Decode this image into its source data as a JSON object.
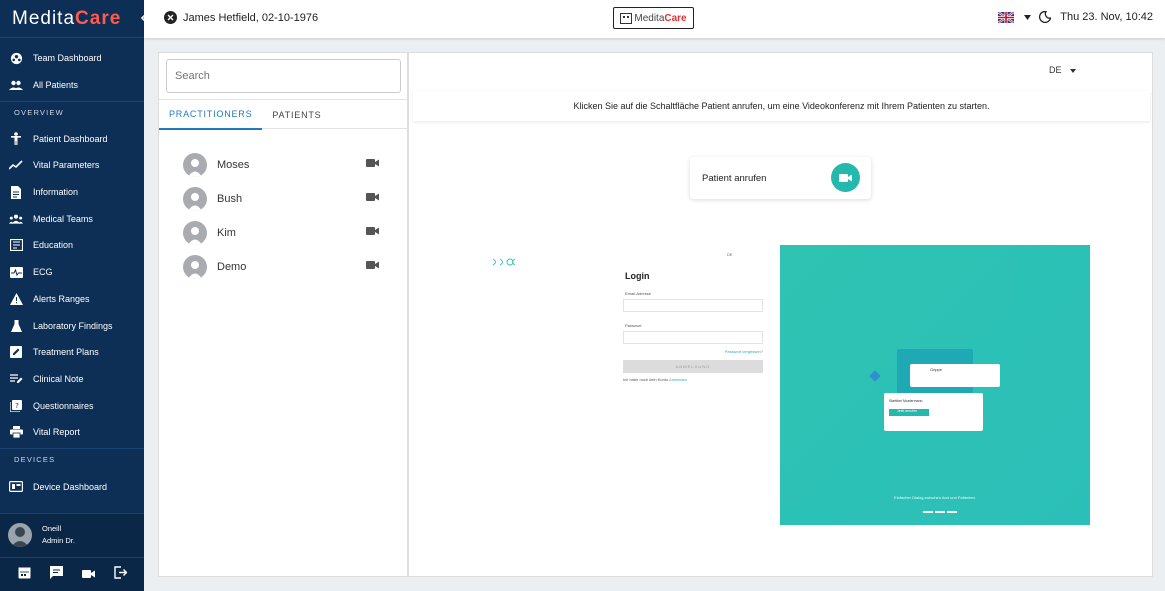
{
  "sidebar": {
    "logo_text_a": "Medita",
    "logo_text_b": "Care",
    "items_top": [
      {
        "label": "Team Dashboard",
        "icon": "team-dashboard-icon"
      },
      {
        "label": "All Patients",
        "icon": "people-icon"
      }
    ],
    "section_overview": "OVERVIEW",
    "items_overview": [
      {
        "label": "Patient Dashboard",
        "icon": "person-icon"
      },
      {
        "label": "Vital Parameters",
        "icon": "trend-icon"
      },
      {
        "label": "Information",
        "icon": "document-icon"
      },
      {
        "label": "Medical Teams",
        "icon": "group-icon"
      },
      {
        "label": "Education",
        "icon": "book-icon"
      },
      {
        "label": "ECG",
        "icon": "ecg-icon"
      },
      {
        "label": "Alerts Ranges",
        "icon": "warning-icon"
      },
      {
        "label": "Laboratory Findings",
        "icon": "flask-icon"
      },
      {
        "label": "Treatment Plans",
        "icon": "edit-square-icon"
      },
      {
        "label": "Clinical Note",
        "icon": "note-icon"
      },
      {
        "label": "Questionnaires",
        "icon": "quiz-icon"
      },
      {
        "label": "Vital Report",
        "icon": "print-icon"
      }
    ],
    "section_devices": "DEVICES",
    "items_devices": [
      {
        "label": "Device Dashboard",
        "icon": "device-icon"
      }
    ],
    "user": {
      "name": "Oneill",
      "role": "Admin Dr."
    }
  },
  "topbar": {
    "patient": "James Hetfield, 02-10-1976",
    "logo_a": "Medita",
    "logo_b": "Care",
    "datetime": "Thu 23. Nov, 10:42"
  },
  "left_panel": {
    "search_placeholder": "Search",
    "tabs": [
      "PRACTITIONERS",
      "PATIENTS"
    ],
    "contacts": [
      "Moses",
      "Bush",
      "Kim",
      "Demo"
    ]
  },
  "right_panel": {
    "lang": "DE",
    "banner": "Klicken Sie auf die Schaltfläche Patient anrufen, um eine Videokonferenz mit Ihrem Patienten zu starten.",
    "call_label": "Patient anrufen",
    "preview": {
      "login_title": "Login",
      "email_label": "Email-Adresse",
      "password_label": "Passwort",
      "forgot": "Passwort vergessen?",
      "login_btn": "ANMELDUNG",
      "no_account": "Ich habe noch kein Konto",
      "register": "Anmelden",
      "lang_small": "DE",
      "teal_caption": "Einfacher Dialog zwischen Arzt und Patienten.",
      "card_title": "Grippe",
      "card2_title": "Starttbei Mustermann",
      "card2_btn": "Jetzt anrufen"
    }
  },
  "colors": {
    "sidebar": "#0d2f56",
    "accent": "#1f7abf",
    "teal": "#25b9ad",
    "logo_red": "#ff5a4e"
  }
}
